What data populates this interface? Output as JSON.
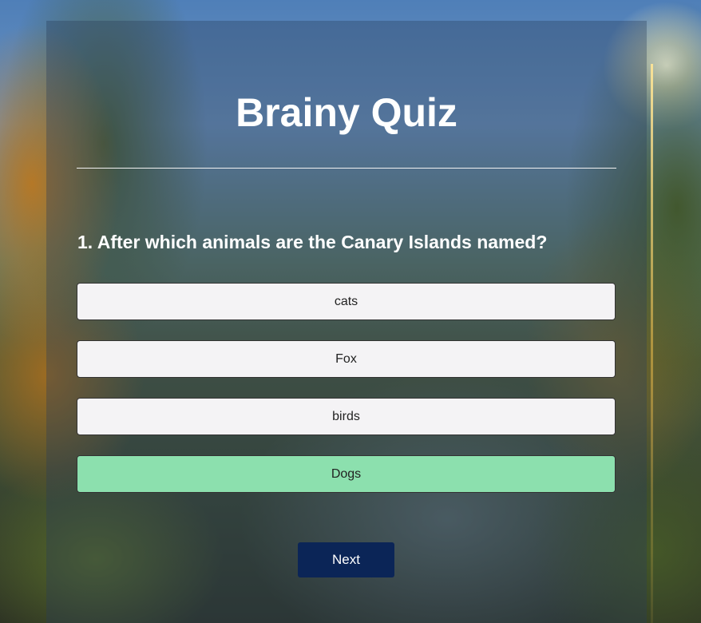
{
  "quiz": {
    "title": "Brainy Quiz",
    "question": "1. After which animals are the Canary Islands named?",
    "answers": [
      {
        "label": "cats",
        "state": "default"
      },
      {
        "label": "Fox",
        "state": "default"
      },
      {
        "label": "birds",
        "state": "default"
      },
      {
        "label": "Dogs",
        "state": "correct"
      }
    ],
    "next_label": "Next"
  },
  "colors": {
    "answer_default": "#f4f3f5",
    "answer_correct": "#8ce0ae",
    "next_button": "#0b2557",
    "text_light": "#ffffff"
  }
}
